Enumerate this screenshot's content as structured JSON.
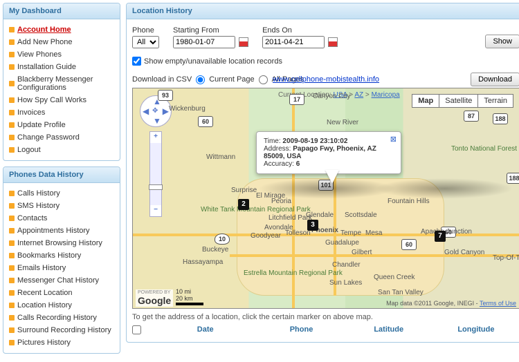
{
  "sidebar": {
    "dashboard": {
      "title": "My Dashboard",
      "items": [
        {
          "label": "Account Home",
          "active": true
        },
        {
          "label": "Add New Phone",
          "muted": true
        },
        {
          "label": "View Phones"
        },
        {
          "label": "Installation Guide",
          "muted": true
        },
        {
          "label": "Blackberry Messenger Configurations",
          "wrap": true
        },
        {
          "label": "How Spy Call Works"
        },
        {
          "label": "Invoices",
          "muted": true
        },
        {
          "label": "Update Profile",
          "muted": true
        },
        {
          "label": "Change Password",
          "muted": true
        },
        {
          "label": "Logout"
        }
      ]
    },
    "history": {
      "title": "Phones Data History",
      "items": [
        {
          "label": "Calls History"
        },
        {
          "label": "SMS History"
        },
        {
          "label": "Contacts"
        },
        {
          "label": "Appointments History"
        },
        {
          "label": "Internet Browsing History"
        },
        {
          "label": "Bookmarks History"
        },
        {
          "label": "Emails History"
        },
        {
          "label": "Messenger Chat History"
        },
        {
          "label": "Recent Location"
        },
        {
          "label": "Location History"
        },
        {
          "label": "Calls Recording History"
        },
        {
          "label": "Surround Recording History",
          "wrap": true
        },
        {
          "label": "Pictures History"
        }
      ]
    }
  },
  "main": {
    "title": "Location History",
    "filters": {
      "phone_label": "Phone",
      "phone_value": "All",
      "from_label": "Starting From",
      "from_value": "1980-01-07",
      "to_label": "Ends On",
      "to_value": "2011-04-21",
      "show_btn": "Show",
      "checkbox_label": "Show empty/unavailable location records"
    },
    "download": {
      "label": "Download in CSV",
      "opt_current": "Current Page",
      "opt_all": "All Pages",
      "btn": "Download"
    },
    "promo_url": "www.cellphone-mobistealth.info",
    "map": {
      "breadcrumb_prefix": "Current Location:",
      "bc1": "USA",
      "bc2": "AZ",
      "bc3": "Maricopa",
      "types": {
        "map": "Map",
        "sat": "Satellite",
        "ter": "Terrain"
      },
      "info": {
        "time_lbl": "Time:",
        "time_val": "2009-08-19 23:10:02",
        "addr_lbl": "Address:",
        "addr_val": "Papago Fwy, Phoenix, AZ 85009, USA",
        "acc_lbl": "Accuracy:",
        "acc_val": "6"
      },
      "markers": {
        "m2": "2",
        "m3": "3",
        "m7": "7"
      },
      "cities": {
        "wickenburg": "Wickenburg",
        "wittmann": "Wittmann",
        "surprise": "Surprise",
        "elmirage": "El Mirage",
        "peoria": "Peoria",
        "glendale": "Glendale",
        "phoenix": "Phoenix",
        "scottsdale": "Scottsdale",
        "tempe": "Tempe",
        "mesa": "Mesa",
        "gilbert": "Gilbert",
        "chandler": "Chandler",
        "guadalupe": "Guadalupe",
        "goodyear": "Goodyear",
        "avondale": "Avondale",
        "tolleson": "Tolleson",
        "litchfield": "Litchfield Park",
        "buckeye": "Buckeye",
        "hassayampa": "Hassayampa",
        "fountain": "Fountain Hills",
        "apache": "Apache Junction",
        "suntan": "San Tan Valley",
        "queencreek": "Queen Creek",
        "sunlakes": "Sun Lakes",
        "canyon": "Canyon City",
        "newriver": "New River",
        "goldcanyon": "Gold Canyon",
        "topofthe": "Top-Of-The"
      },
      "parks": {
        "tonto": "Tonto National Forest",
        "whitetank": "White Tank Mountain Regional Park",
        "estrella": "Estrella Mountain Regional Park"
      },
      "shields": {
        "r93": "93",
        "r60a": "60",
        "r60b": "60",
        "r60c": "60",
        "r17": "17",
        "r101": "101",
        "r87": "87",
        "r188": "188",
        "r188b": "188",
        "i10": "10"
      },
      "scale": {
        "mi": "10 mi",
        "km": "20 km"
      },
      "powered": "POWERED BY",
      "google": "Google",
      "attrib": "Map data ©2011 Google, INEGI -",
      "tou": "Terms of Use"
    },
    "hint": "To get the address of a location, click the certain marker on above map.",
    "table": {
      "date": "Date",
      "phone": "Phone",
      "lat": "Latitude",
      "lon": "Longitude"
    }
  }
}
